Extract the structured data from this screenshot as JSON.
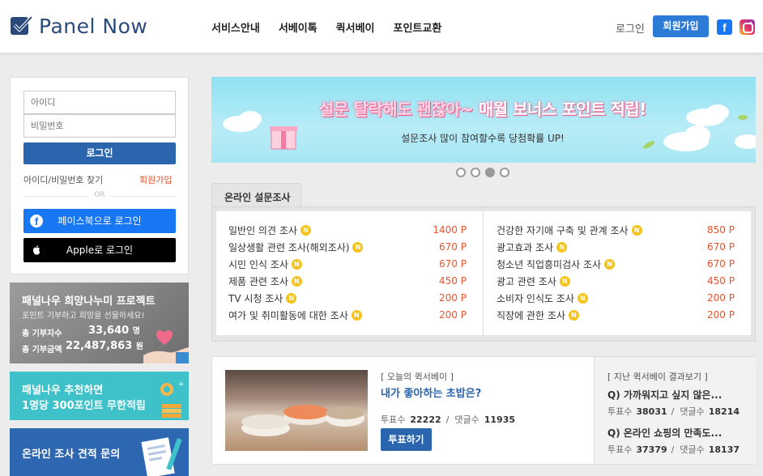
{
  "header": {
    "logo_text": "Panel Now",
    "nav": [
      "서비스안내",
      "서베이톡",
      "퀵서베이",
      "포인트교환"
    ],
    "login_label": "로그인",
    "join_label": "회원가입",
    "facebook_glyph": "f",
    "colors": {
      "accent": "#2b7bd7",
      "brand_dark": "#2a4a7a"
    }
  },
  "login": {
    "id_placeholder": "아이디",
    "pw_placeholder": "비밀번호",
    "login_button": "로그인",
    "find_label": "아이디/비밀번호 찾기",
    "join_label": "회원가입",
    "or_label": "OR",
    "facebook_label": "페이스북으로 로그인",
    "apple_label": "Apple로 로그인"
  },
  "side": {
    "hope_title": "패널나우 희망나누미 프로젝트",
    "hope_sub": "포인트 기부하고 희망을 선물하세요!",
    "donor_label": "총 기부자수",
    "donor_value": "33,640",
    "donor_unit": "명",
    "amount_label": "총 기부금액",
    "amount_value": "22,487,863",
    "amount_unit": "원",
    "rec_line1": "패널나우 추천하면",
    "rec_line2": "1명당 300포인트 무한적립",
    "estimate_label": "온라인 조사 견적 문의"
  },
  "banner": {
    "headline_a": "설문 탈락해도 괜찮아~",
    "headline_b": " 매월 보너스 포인트 적립!",
    "sub": "설문조사 많이 참여할수록 당첨확률 UP!",
    "active_dot": 3,
    "dot_count": 4
  },
  "survey": {
    "tab_label": "온라인 설문조사",
    "badge": "N",
    "left": [
      {
        "title": "일반인 의견 조사",
        "points": "1400 P"
      },
      {
        "title": "일상생활 관련 조사(해외조사)",
        "points": "670 P"
      },
      {
        "title": "시민 인식 조사",
        "points": "670 P"
      },
      {
        "title": "제품 관련 조사",
        "points": "450 P"
      },
      {
        "title": "TV 시청 조사",
        "points": "200 P"
      },
      {
        "title": "여가 및 취미활동에 대한 조사",
        "points": "200 P"
      }
    ],
    "right": [
      {
        "title": "건강한 자기애 구축 및 관계 조사",
        "points": "850 P"
      },
      {
        "title": "광고효과 조사",
        "points": "670 P"
      },
      {
        "title": "청소년 직업흥미검사 조사",
        "points": "670 P"
      },
      {
        "title": "광고 관련 조사",
        "points": "450 P"
      },
      {
        "title": "소비자 인식도 조사",
        "points": "200 P"
      },
      {
        "title": "직장에 관한 조사",
        "points": "200 P"
      }
    ]
  },
  "quiz": {
    "tag": "[ 오늘의 퀵서베이 ]",
    "title": "내가 좋아하는 초밥은?",
    "votes_label": "투표수",
    "votes": "22222",
    "comments_label": "댓글수",
    "comments": "11935",
    "vote_button": "투표하기",
    "past_title": "[ 지난 퀵서베이 결과보기 ]",
    "past": [
      {
        "q": "Q) 가까워지고 싶지 않은...",
        "votes": "38031",
        "comments": "18214"
      },
      {
        "q": "Q) 온라인 쇼핑의 만족도...",
        "votes": "37379",
        "comments": "18137"
      }
    ]
  }
}
